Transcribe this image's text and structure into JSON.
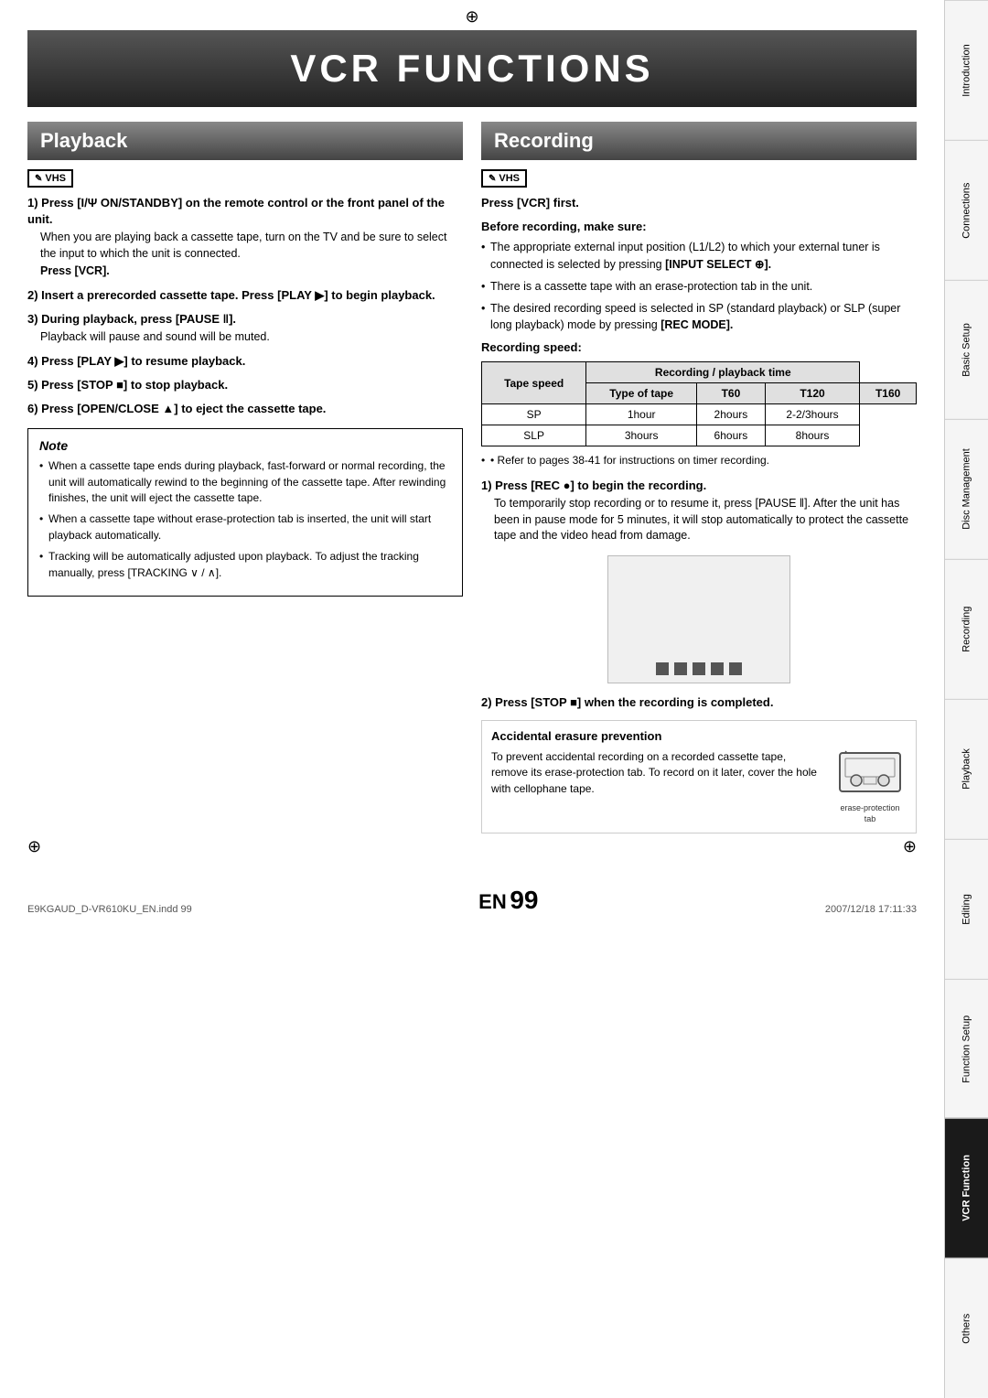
{
  "page": {
    "title": "VCR FUNCTIONS",
    "top_mark": "⊕",
    "bottom_left_mark": "⊕",
    "bottom_right_mark": "⊕",
    "footer_filename": "E9KGAUD_D-VR610KU_EN.indd  99",
    "footer_date": "2007/12/18  17:11:33",
    "footer_en": "EN",
    "footer_page": "99"
  },
  "sidebar": {
    "tabs": [
      {
        "label": "Introduction",
        "active": false
      },
      {
        "label": "Connections",
        "active": false
      },
      {
        "label": "Basic Setup",
        "active": false
      },
      {
        "label": "Disc Management",
        "active": false
      },
      {
        "label": "Recording",
        "active": false
      },
      {
        "label": "Playback",
        "active": false
      },
      {
        "label": "Editing",
        "active": false
      },
      {
        "label": "Function Setup",
        "active": false
      },
      {
        "label": "VCR Function",
        "active": true
      },
      {
        "label": "Others",
        "active": false
      }
    ]
  },
  "playback": {
    "title": "Playback",
    "vhs_label": "VHS",
    "step1_bold": "1) Press [I/Ψ ON/STANDBY] on the remote control or the front panel of the unit.",
    "step1_text": "When you are playing back a cassette tape, turn on the TV and be sure to select the input to which the unit is connected.",
    "step1_press": "Press [VCR].",
    "step2_bold": "2) Insert a prerecorded cassette tape. Press [PLAY ▶] to begin playback.",
    "step3_bold": "3) During playback, press [PAUSE ‖].",
    "step3_text": "Playback will pause and sound will be muted.",
    "step4_bold": "4) Press [PLAY ▶] to resume playback.",
    "step5_bold": "5) Press [STOP ■] to stop playback.",
    "step6_bold": "6) Press [OPEN/CLOSE ▲] to eject the cassette tape.",
    "note_title": "Note",
    "note_items": [
      "When a cassette tape ends during playback, fast-forward or normal recording, the unit will automatically rewind to the beginning of the cassette tape. After rewinding finishes, the unit will eject the cassette tape.",
      "When a cassette tape without erase-protection tab is inserted, the unit will start playback automatically.",
      "Tracking will be automatically adjusted upon playback. To adjust the tracking manually, press [TRACKING ∨ / ∧]."
    ]
  },
  "recording": {
    "title": "Recording",
    "vhs_label": "VHS",
    "press_vcr_label": "Press [VCR] first.",
    "before_rec_label": "Before recording, make sure:",
    "bullet1": "The appropriate external input position (L1/L2) to which your external tuner is connected is selected by pressing [INPUT SELECT ⊕].",
    "bullet2": "There is a cassette tape with an erase-protection tab in the unit.",
    "bullet3": "The desired recording speed is selected in SP (standard playback) or SLP (super long playback) mode by pressing [REC MODE].",
    "rec_speed_label": "Recording speed:",
    "table": {
      "header_col1": "Tape speed",
      "header_col2": "Recording / playback time",
      "sub_header_col1": "Type of tape",
      "sub_header_t60": "T60",
      "sub_header_t120": "T120",
      "sub_header_t160": "T160",
      "row_sp_label": "SP",
      "row_sp_t60": "1hour",
      "row_sp_t120": "2hours",
      "row_sp_t160": "2-2/3hours",
      "row_slp_label": "SLP",
      "row_slp_t60": "3hours",
      "row_slp_t120": "6hours",
      "row_slp_t160": "8hours"
    },
    "refer_note": "• Refer to pages 38-41 for instructions on timer recording.",
    "step1_bold": "1) Press [REC ●] to begin the recording.",
    "step1_text": "To temporarily stop recording or to resume it, press [PAUSE ‖]. After the unit has been in pause mode for 5 minutes, it will stop automatically to protect the cassette tape and the video head from damage.",
    "step2_bold": "2) Press [STOP ■] when the recording is completed.",
    "erasure_title": "Accidental erasure prevention",
    "erasure_text": "To prevent accidental recording on a recorded cassette tape, remove its erase-protection tab. To record on it later, cover the hole with cellophane tape.",
    "erasure_tab_label": "erase-protection tab"
  }
}
